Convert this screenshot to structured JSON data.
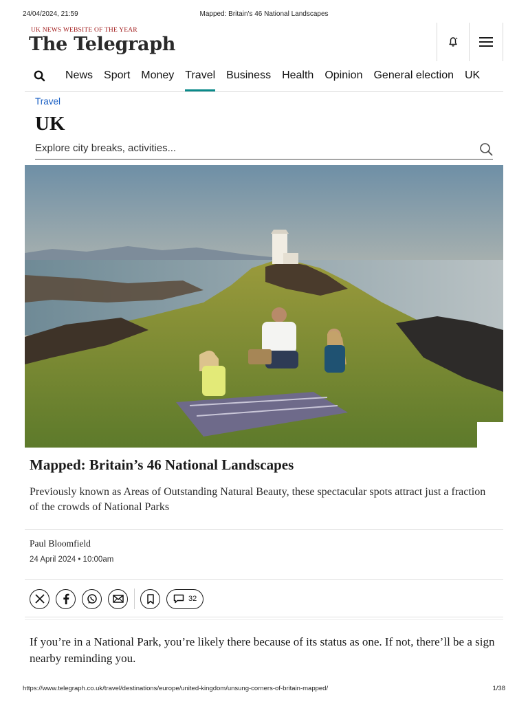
{
  "print_header": {
    "datetime": "24/04/2024, 21:59",
    "page_title": "Mapped: Britain's 46 National Landscapes"
  },
  "masthead": {
    "award": "UK NEWS WEBSITE OF THE YEAR",
    "logo": "The Telegraph",
    "icons": {
      "notifications": "bell-icon",
      "menu": "hamburger-menu-icon"
    }
  },
  "nav": {
    "search_icon": "search-icon",
    "items": [
      "News",
      "Sport",
      "Money",
      "Travel",
      "Business",
      "Health",
      "Opinion",
      "General election",
      "UK"
    ],
    "active": "Travel",
    "accent_color": "#0a8a8a"
  },
  "section": {
    "kicker": "Travel",
    "heading": "UK",
    "kicker_color": "#1a5fc4"
  },
  "explore": {
    "placeholder": "Explore city breaks, activities..."
  },
  "article": {
    "headline": "Mapped: Britain’s 46 National Landscapes",
    "standfirst": "Previously known as Areas of Outstanding Natural Beauty, these spectacular spots attract just a fraction of the crowds of National Parks",
    "author": "Paul Bloomfield",
    "published": "24 April 2024 • 10:00am",
    "share_icons": [
      "x-icon",
      "facebook-icon",
      "whatsapp-icon",
      "email-icon",
      "bookmark-icon"
    ],
    "comment_count": "32",
    "first_paragraph": "If you’re in a National Park, you’re likely there because of its status as one. If not, there’ll be a sign nearby reminding you."
  },
  "print_footer": {
    "url": "https://www.telegraph.co.uk/travel/destinations/europe/united-kingdom/unsung-corners-of-britain-mapped/",
    "page": "1/38"
  }
}
